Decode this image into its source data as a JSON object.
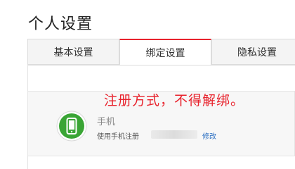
{
  "page": {
    "title": "个人设置"
  },
  "tabs": [
    {
      "label": "基本设置"
    },
    {
      "label": "绑定设置"
    },
    {
      "label": "隐私设置"
    }
  ],
  "colors": {
    "accent": "#e8232d",
    "link": "#2b6fc2",
    "phone_icon": "#3aa535"
  },
  "binding": {
    "icon": "phone-icon",
    "title": "手机",
    "description": "使用手机注册",
    "edit_label": "修改"
  },
  "annotation": {
    "text": "注册方式，不得解绑。"
  }
}
